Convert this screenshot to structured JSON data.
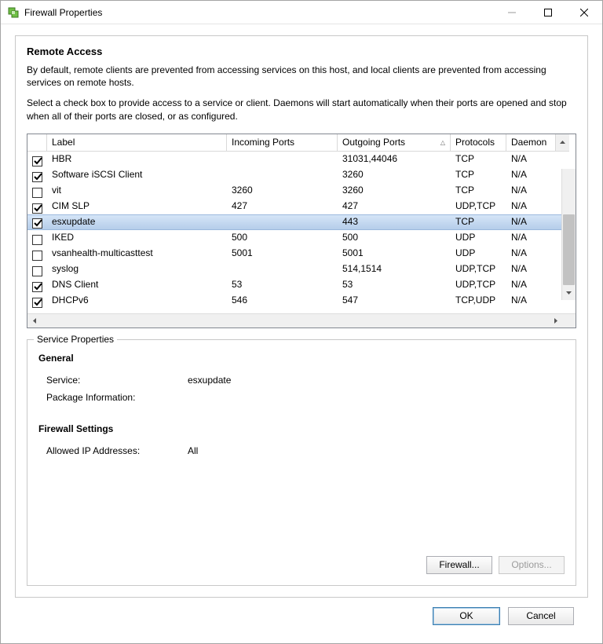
{
  "window": {
    "title": "Firewall Properties"
  },
  "header": {
    "title": "Remote Access",
    "paragraph1": "By default, remote clients are prevented from accessing services on this host, and local clients are prevented from accessing services on remote hosts.",
    "paragraph2": "Select a check box to provide access to a service or client. Daemons will start automatically when their ports are opened and stop when all of their ports are closed, or as configured."
  },
  "grid": {
    "columns": {
      "label": "Label",
      "incoming": "Incoming Ports",
      "outgoing": "Outgoing Ports",
      "protocols": "Protocols",
      "daemon": "Daemon"
    },
    "rows": [
      {
        "checked": true,
        "label": "HBR",
        "incoming": "",
        "outgoing": "31031,44046",
        "protocols": "TCP",
        "daemon": "N/A",
        "selected": false
      },
      {
        "checked": true,
        "label": "Software iSCSI Client",
        "incoming": "",
        "outgoing": "3260",
        "protocols": "TCP",
        "daemon": "N/A",
        "selected": false
      },
      {
        "checked": false,
        "label": "vit",
        "incoming": "3260",
        "outgoing": "3260",
        "protocols": "TCP",
        "daemon": "N/A",
        "selected": false
      },
      {
        "checked": true,
        "label": "CIM SLP",
        "incoming": "427",
        "outgoing": "427",
        "protocols": "UDP,TCP",
        "daemon": "N/A",
        "selected": false
      },
      {
        "checked": true,
        "label": "esxupdate",
        "incoming": "",
        "outgoing": "443",
        "protocols": "TCP",
        "daemon": "N/A",
        "selected": true
      },
      {
        "checked": false,
        "label": "IKED",
        "incoming": "500",
        "outgoing": "500",
        "protocols": "UDP",
        "daemon": "N/A",
        "selected": false
      },
      {
        "checked": false,
        "label": "vsanhealth-multicasttest",
        "incoming": "5001",
        "outgoing": "5001",
        "protocols": "UDP",
        "daemon": "N/A",
        "selected": false
      },
      {
        "checked": false,
        "label": "syslog",
        "incoming": "",
        "outgoing": "514,1514",
        "protocols": "UDP,TCP",
        "daemon": "N/A",
        "selected": false
      },
      {
        "checked": true,
        "label": "DNS Client",
        "incoming": "53",
        "outgoing": "53",
        "protocols": "UDP,TCP",
        "daemon": "N/A",
        "selected": false
      },
      {
        "checked": true,
        "label": "DHCPv6",
        "incoming": "546",
        "outgoing": "547",
        "protocols": "TCP,UDP",
        "daemon": "N/A",
        "selected": false
      }
    ],
    "sort_column": "outgoing",
    "sort_dir": "asc"
  },
  "service_properties": {
    "legend": "Service Properties",
    "general_heading": "General",
    "service_label": "Service:",
    "service_value": "esxupdate",
    "package_label": "Package Information:",
    "package_value": "",
    "firewall_heading": "Firewall Settings",
    "allowed_label": "Allowed IP Addresses:",
    "allowed_value": "All",
    "buttons": {
      "firewall": "Firewall...",
      "options": "Options..."
    }
  },
  "footer": {
    "ok": "OK",
    "cancel": "Cancel"
  }
}
